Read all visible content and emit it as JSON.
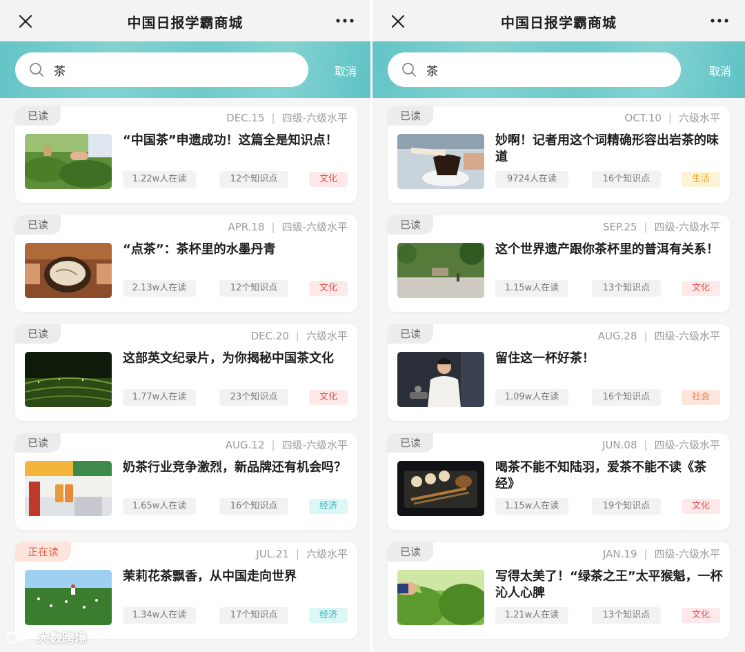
{
  "colors": {
    "accent": "#6fcac9",
    "card_bg": "#ffffff",
    "page_bg": "#f5f5f5",
    "culture": "#e45353",
    "economy": "#2bb1b6",
    "life": "#e8a620",
    "society": "#ec7a4c",
    "reading": "#e0654a"
  },
  "panels": [
    {
      "title": "中国日报学霸商城",
      "close_icon": "close-icon",
      "more_icon": "more-icon",
      "search": {
        "value": "茶",
        "icon": "search-icon",
        "cancel_label": "取消"
      },
      "articles": [
        {
          "status": "已读",
          "date": "DEC.15",
          "level": "四级-六级水平",
          "title": "“中国茶”申遗成功！这篇全是知识点！",
          "readers": "1.22w人在读",
          "points": "12个知识点",
          "category": "文化",
          "category_style": "red",
          "image": "tea-plantation-picking"
        },
        {
          "status": "已读",
          "date": "APR.18",
          "level": "四级-六级水平",
          "title": "“点茶”：茶杯里的水墨丹青",
          "readers": "2.13w人在读",
          "points": "12个知识点",
          "category": "文化",
          "category_style": "red",
          "image": "tea-bowl-hands"
        },
        {
          "status": "已读",
          "date": "DEC.20",
          "level": "六级水平",
          "title": "这部英文纪录片，为你揭秘中国茶文化",
          "readers": "1.77w人在读",
          "points": "23个知识点",
          "category": "文化",
          "category_style": "red",
          "image": "night-tea-field"
        },
        {
          "status": "已读",
          "date": "AUG.12",
          "level": "四级-六级水平",
          "title": "奶茶行业竞争激烈，新品牌还有机会吗？",
          "readers": "1.65w人在读",
          "points": "16个知识点",
          "category": "经济",
          "category_style": "teal",
          "image": "milk-tea-shop"
        },
        {
          "status": "正在读",
          "date": "JUL.21",
          "level": "六级水平",
          "title": "茉莉花茶飘香，从中国走向世界",
          "readers": "1.34w人在读",
          "points": "17个知识点",
          "category": "经济",
          "category_style": "teal",
          "image": "jasmine-field"
        }
      ]
    },
    {
      "title": "中国日报学霸商城",
      "close_icon": "close-icon",
      "more_icon": "more-icon",
      "search": {
        "value": "茶",
        "icon": "search-icon",
        "cancel_label": "取消"
      },
      "articles": [
        {
          "status": "已读",
          "date": "OCT.10",
          "level": "六级水平",
          "title": "妙啊！记者用这个词精确形容出岩茶的味道",
          "readers": "9724人在读",
          "points": "16个知识点",
          "category": "生活",
          "category_style": "yellow",
          "image": "pouring-tea-leaves"
        },
        {
          "status": "已读",
          "date": "SEP.25",
          "level": "四级-六级水平",
          "title": "这个世界遗产跟你茶杯里的普洱有关系！",
          "readers": "1.15w人在读",
          "points": "13个知识点",
          "category": "文化",
          "category_style": "red",
          "image": "forest-village"
        },
        {
          "status": "已读",
          "date": "AUG.28",
          "level": "四级-六级水平",
          "title": "留住这一杯好茶！",
          "readers": "1.09w人在读",
          "points": "16个知识点",
          "category": "社会",
          "category_style": "orange",
          "image": "tea-master"
        },
        {
          "status": "已读",
          "date": "JUN.08",
          "level": "四级-六级水平",
          "title": "喝茶不能不知陆羽，爱茶不能不读《茶经》",
          "readers": "1.15w人在读",
          "points": "19个知识点",
          "category": "文化",
          "category_style": "red",
          "image": "tea-set"
        },
        {
          "status": "已读",
          "date": "JAN.19",
          "level": "四级-六级水平",
          "title": "写得太美了！“绿茶之王”太平猴魁，一杯沁人心脾",
          "readers": "1.21w人在读",
          "points": "13个知识点",
          "category": "文化",
          "category_style": "red",
          "image": "green-tea-hand"
        }
      ]
    }
  ],
  "watermark": {
    "text": "大数跨境",
    "logo": "watermark-logo"
  }
}
